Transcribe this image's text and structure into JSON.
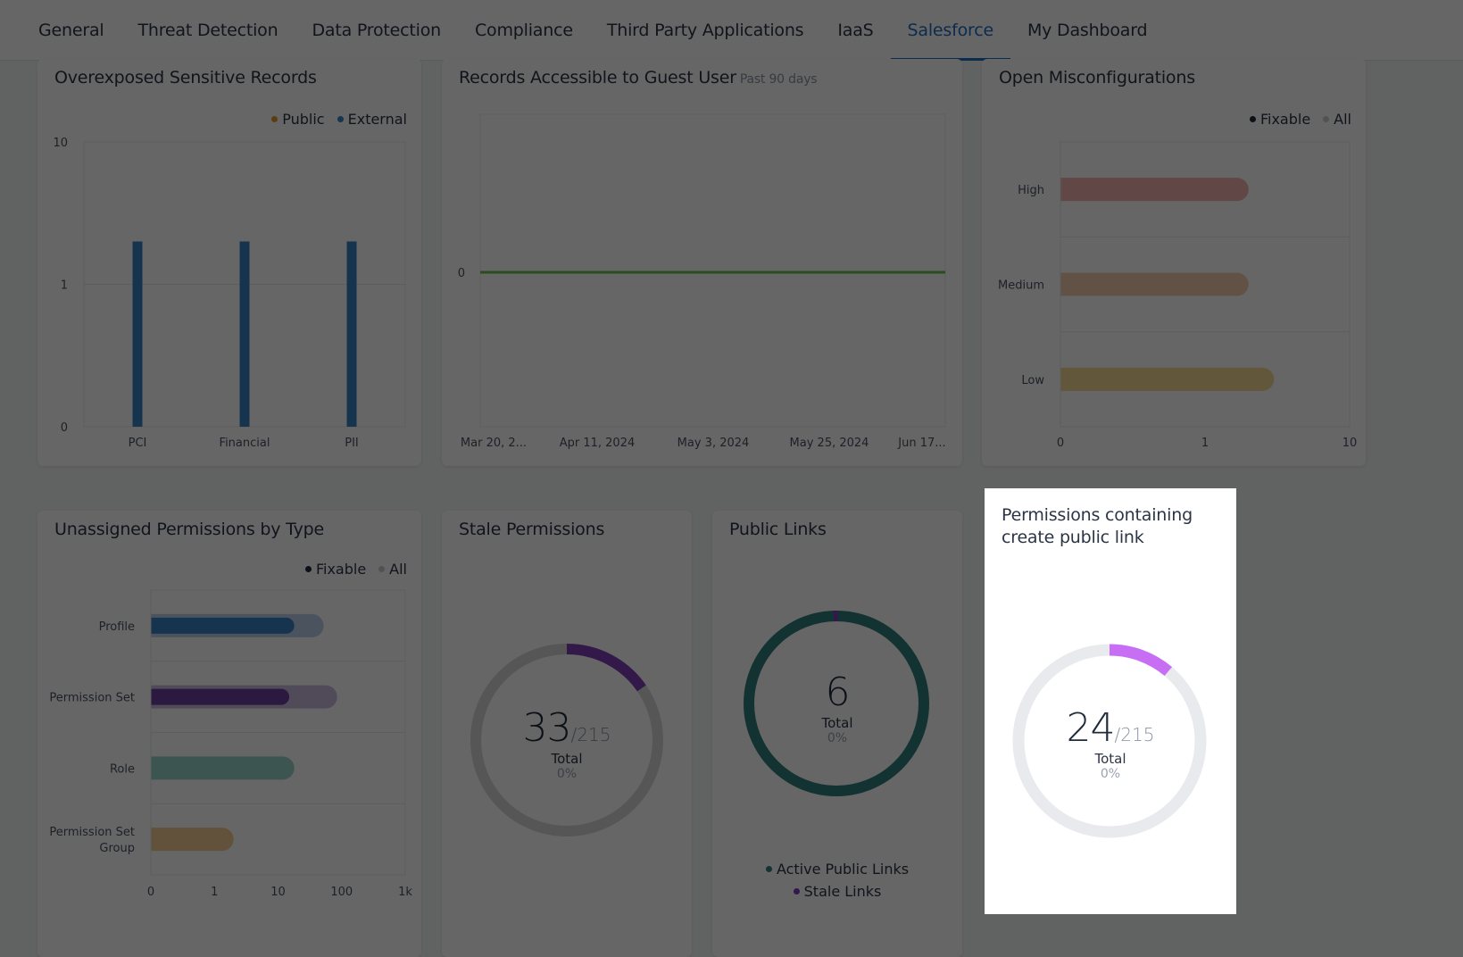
{
  "tabs": [
    {
      "label": "General",
      "active": false
    },
    {
      "label": "Threat Detection",
      "active": false
    },
    {
      "label": "Data Protection",
      "active": false
    },
    {
      "label": "Compliance",
      "active": false
    },
    {
      "label": "Third Party Applications",
      "active": false
    },
    {
      "label": "IaaS",
      "active": false
    },
    {
      "label": "Salesforce",
      "active": true
    },
    {
      "label": "My Dashboard",
      "active": false
    }
  ],
  "colors": {
    "accent": "#1f6fc4",
    "public": "#e39a2b",
    "external": "#3b82c4",
    "line_green": "#6abf4b",
    "high": "#f2a9a3",
    "medium": "#f5c6a5",
    "low": "#f3d48a",
    "profile": "#3b82c4",
    "permission_set": "#6b3fa0",
    "role": "#8ccfc2",
    "psg": "#f3c98a",
    "stale_purple": "#7d3fb8",
    "teal": "#2f7f7a",
    "bright_purple": "#c86ef5",
    "track": "#e9eaed"
  },
  "chart_data": [
    {
      "id": "overexposed",
      "type": "bar",
      "title": "Overexposed Sensitive Records",
      "categories": [
        "PCI",
        "Financial",
        "PII"
      ],
      "series": [
        {
          "name": "Public",
          "values": [
            0,
            0,
            0
          ]
        },
        {
          "name": "External",
          "values": [
            2,
            2,
            2
          ]
        }
      ],
      "y_scale": "log",
      "yticks": [
        "0",
        "1",
        "10"
      ],
      "ylim": [
        0,
        10
      ],
      "legend": "top-right"
    },
    {
      "id": "guest",
      "type": "line",
      "title": "Records Accessible to Guest User",
      "subtitle": "Past 90 days",
      "x_ticks": [
        "Mar 20, 2...",
        "Apr 11, 2024",
        "May 3, 2024",
        "May 25, 2024",
        "Jun 17..."
      ],
      "yticks": [
        "0"
      ],
      "series": [
        {
          "name": "Records",
          "values": [
            0,
            0,
            0,
            0,
            0
          ]
        }
      ]
    },
    {
      "id": "misconfig",
      "type": "bar",
      "orientation": "horizontal",
      "title": "Open Misconfigurations",
      "categories": [
        "High",
        "Medium",
        "Low"
      ],
      "series": [
        {
          "name": "Fixable",
          "values": [
            0,
            0,
            0
          ]
        },
        {
          "name": "All",
          "values": [
            2,
            2,
            3
          ]
        }
      ],
      "x_scale": "log",
      "xticks": [
        "0",
        "1",
        "10"
      ],
      "legend": "top-right"
    },
    {
      "id": "unassigned",
      "type": "bar",
      "orientation": "horizontal",
      "title": "Unassigned Permissions by Type",
      "categories": [
        "Profile",
        "Permission Set",
        "Role",
        "Permission Set Group"
      ],
      "series": [
        {
          "name": "Fixable",
          "values": [
            18,
            15,
            0,
            0
          ]
        },
        {
          "name": "All",
          "values": [
            52,
            85,
            18,
            2
          ]
        }
      ],
      "x_scale": "log",
      "xticks": [
        "0",
        "1",
        "10",
        "100",
        "1k"
      ],
      "legend": "top-right"
    },
    {
      "id": "stale",
      "type": "pie",
      "title": "Stale Permissions",
      "value": 33,
      "total": 215,
      "center_label": "Total",
      "percent_label": "0%"
    },
    {
      "id": "public_links",
      "type": "pie",
      "title": "Public Links",
      "slices": [
        {
          "name": "Active Public Links",
          "value": 6
        },
        {
          "name": "Stale Links",
          "value": 0
        }
      ],
      "value": 6,
      "center_label": "Total",
      "percent_label": "0%",
      "legend": "bottom"
    },
    {
      "id": "create_public_link",
      "type": "pie",
      "title": "Permissions containing create public link",
      "value": 24,
      "total": 215,
      "center_label": "Total",
      "percent_label": "0%"
    }
  ],
  "labels": {
    "of_215": "/215",
    "public": "Public",
    "external": "External",
    "fixable": "Fixable",
    "all": "All",
    "active_public_links": "Active Public Links",
    "stale_links": "Stale Links"
  }
}
